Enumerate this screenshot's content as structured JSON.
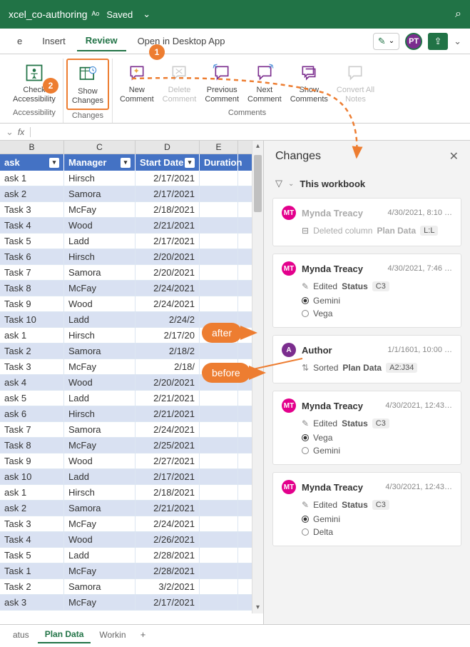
{
  "titlebar": {
    "filename": "xcel_co-authoring",
    "status": "Saved"
  },
  "tabs": {
    "t1": "e",
    "t2": "Insert",
    "t3": "Review",
    "t4": "Open in Desktop App"
  },
  "avatar_initials": "PT",
  "callouts": {
    "c1": "1",
    "c2": "2"
  },
  "ribbon": {
    "accessibility": {
      "btn": "Check\nAccessibility",
      "label": "Accessibility"
    },
    "changes": {
      "btn": "Show\nChanges",
      "label": "Changes"
    },
    "comments": {
      "new": "New\nComment",
      "delete": "Delete\nComment",
      "prev": "Previous\nComment",
      "next": "Next\nComment",
      "show": "Show\nComments",
      "convert": "Convert All\nNotes",
      "label": "Comments"
    }
  },
  "formula": {
    "fx": "fx"
  },
  "columns": {
    "b": "B",
    "c": "C",
    "d": "D",
    "e": "E"
  },
  "headers": {
    "task": "ask",
    "manager": "Manager",
    "start": "Start Date",
    "duration": "Duration"
  },
  "rows": [
    {
      "task": "ask 1",
      "manager": "Hirsch",
      "date": "2/17/2021"
    },
    {
      "task": "ask 2",
      "manager": "Samora",
      "date": "2/17/2021"
    },
    {
      "task": "Task 3",
      "manager": "McFay",
      "date": "2/18/2021"
    },
    {
      "task": "Task 4",
      "manager": "Wood",
      "date": "2/21/2021"
    },
    {
      "task": "Task 5",
      "manager": "Ladd",
      "date": "2/17/2021"
    },
    {
      "task": "Task 6",
      "manager": "Hirsch",
      "date": "2/20/2021"
    },
    {
      "task": "Task 7",
      "manager": "Samora",
      "date": "2/20/2021"
    },
    {
      "task": "Task 8",
      "manager": "McFay",
      "date": "2/24/2021"
    },
    {
      "task": "Task 9",
      "manager": "Wood",
      "date": "2/24/2021"
    },
    {
      "task": "Task 10",
      "manager": "Ladd",
      "date": "2/24/2"
    },
    {
      "task": "ask 1",
      "manager": "Hirsch",
      "date": "2/17/20"
    },
    {
      "task": "Task 2",
      "manager": "Samora",
      "date": "2/18/2"
    },
    {
      "task": "Task 3",
      "manager": "McFay",
      "date": "2/18/"
    },
    {
      "task": "ask 4",
      "manager": "Wood",
      "date": "2/20/2021"
    },
    {
      "task": "ask 5",
      "manager": "Ladd",
      "date": "2/21/2021"
    },
    {
      "task": "ask 6",
      "manager": "Hirsch",
      "date": "2/21/2021"
    },
    {
      "task": "Task 7",
      "manager": "Samora",
      "date": "2/24/2021"
    },
    {
      "task": "Task 8",
      "manager": "McFay",
      "date": "2/25/2021"
    },
    {
      "task": "Task 9",
      "manager": "Wood",
      "date": "2/27/2021"
    },
    {
      "task": "ask 10",
      "manager": "Ladd",
      "date": "2/17/2021"
    },
    {
      "task": "ask 1",
      "manager": "Hirsch",
      "date": "2/18/2021"
    },
    {
      "task": "ask 2",
      "manager": "Samora",
      "date": "2/21/2021"
    },
    {
      "task": "Task 3",
      "manager": "McFay",
      "date": "2/24/2021"
    },
    {
      "task": "Task 4",
      "manager": "Wood",
      "date": "2/26/2021"
    },
    {
      "task": "Task 5",
      "manager": "Ladd",
      "date": "2/28/2021"
    },
    {
      "task": "Task 1",
      "manager": "McFay",
      "date": "2/28/2021"
    },
    {
      "task": "Task 2",
      "manager": "Samora",
      "date": "3/2/2021"
    },
    {
      "task": "ask 3",
      "manager": "McFay",
      "date": "2/17/2021"
    }
  ],
  "sheets": {
    "s1": "atus",
    "s2": "Plan Data",
    "s3": "Workin"
  },
  "panel": {
    "title": "Changes",
    "filter": "This workbook",
    "cards": [
      {
        "avatar": "MT",
        "user": "Mynda Treacy",
        "time": "4/30/2021, 8:10 …",
        "action": "Deleted column",
        "target": "Plan Data",
        "ref": "L:L",
        "muted": true
      },
      {
        "avatar": "MT",
        "user": "Mynda Treacy",
        "time": "4/30/2021, 7:46 …",
        "action": "Edited",
        "target": "Status",
        "ref": "C3",
        "values": [
          {
            "sel": true,
            "v": "Gemini"
          },
          {
            "sel": false,
            "v": "Vega"
          }
        ]
      },
      {
        "avatar": "A",
        "user": "Author",
        "time": "1/1/1601, 10:00 …",
        "action": "Sorted",
        "target": "Plan Data",
        "ref": "A2:J34"
      },
      {
        "avatar": "MT",
        "user": "Mynda Treacy",
        "time": "4/30/2021, 12:43…",
        "action": "Edited",
        "target": "Status",
        "ref": "C3",
        "values": [
          {
            "sel": true,
            "v": "Vega"
          },
          {
            "sel": false,
            "v": "Gemini"
          }
        ]
      },
      {
        "avatar": "MT",
        "user": "Mynda Treacy",
        "time": "4/30/2021, 12:43…",
        "action": "Edited",
        "target": "Status",
        "ref": "C3",
        "values": [
          {
            "sel": true,
            "v": "Gemini"
          },
          {
            "sel": false,
            "v": "Delta"
          }
        ]
      }
    ]
  },
  "annotations": {
    "after": "after",
    "before": "before"
  }
}
